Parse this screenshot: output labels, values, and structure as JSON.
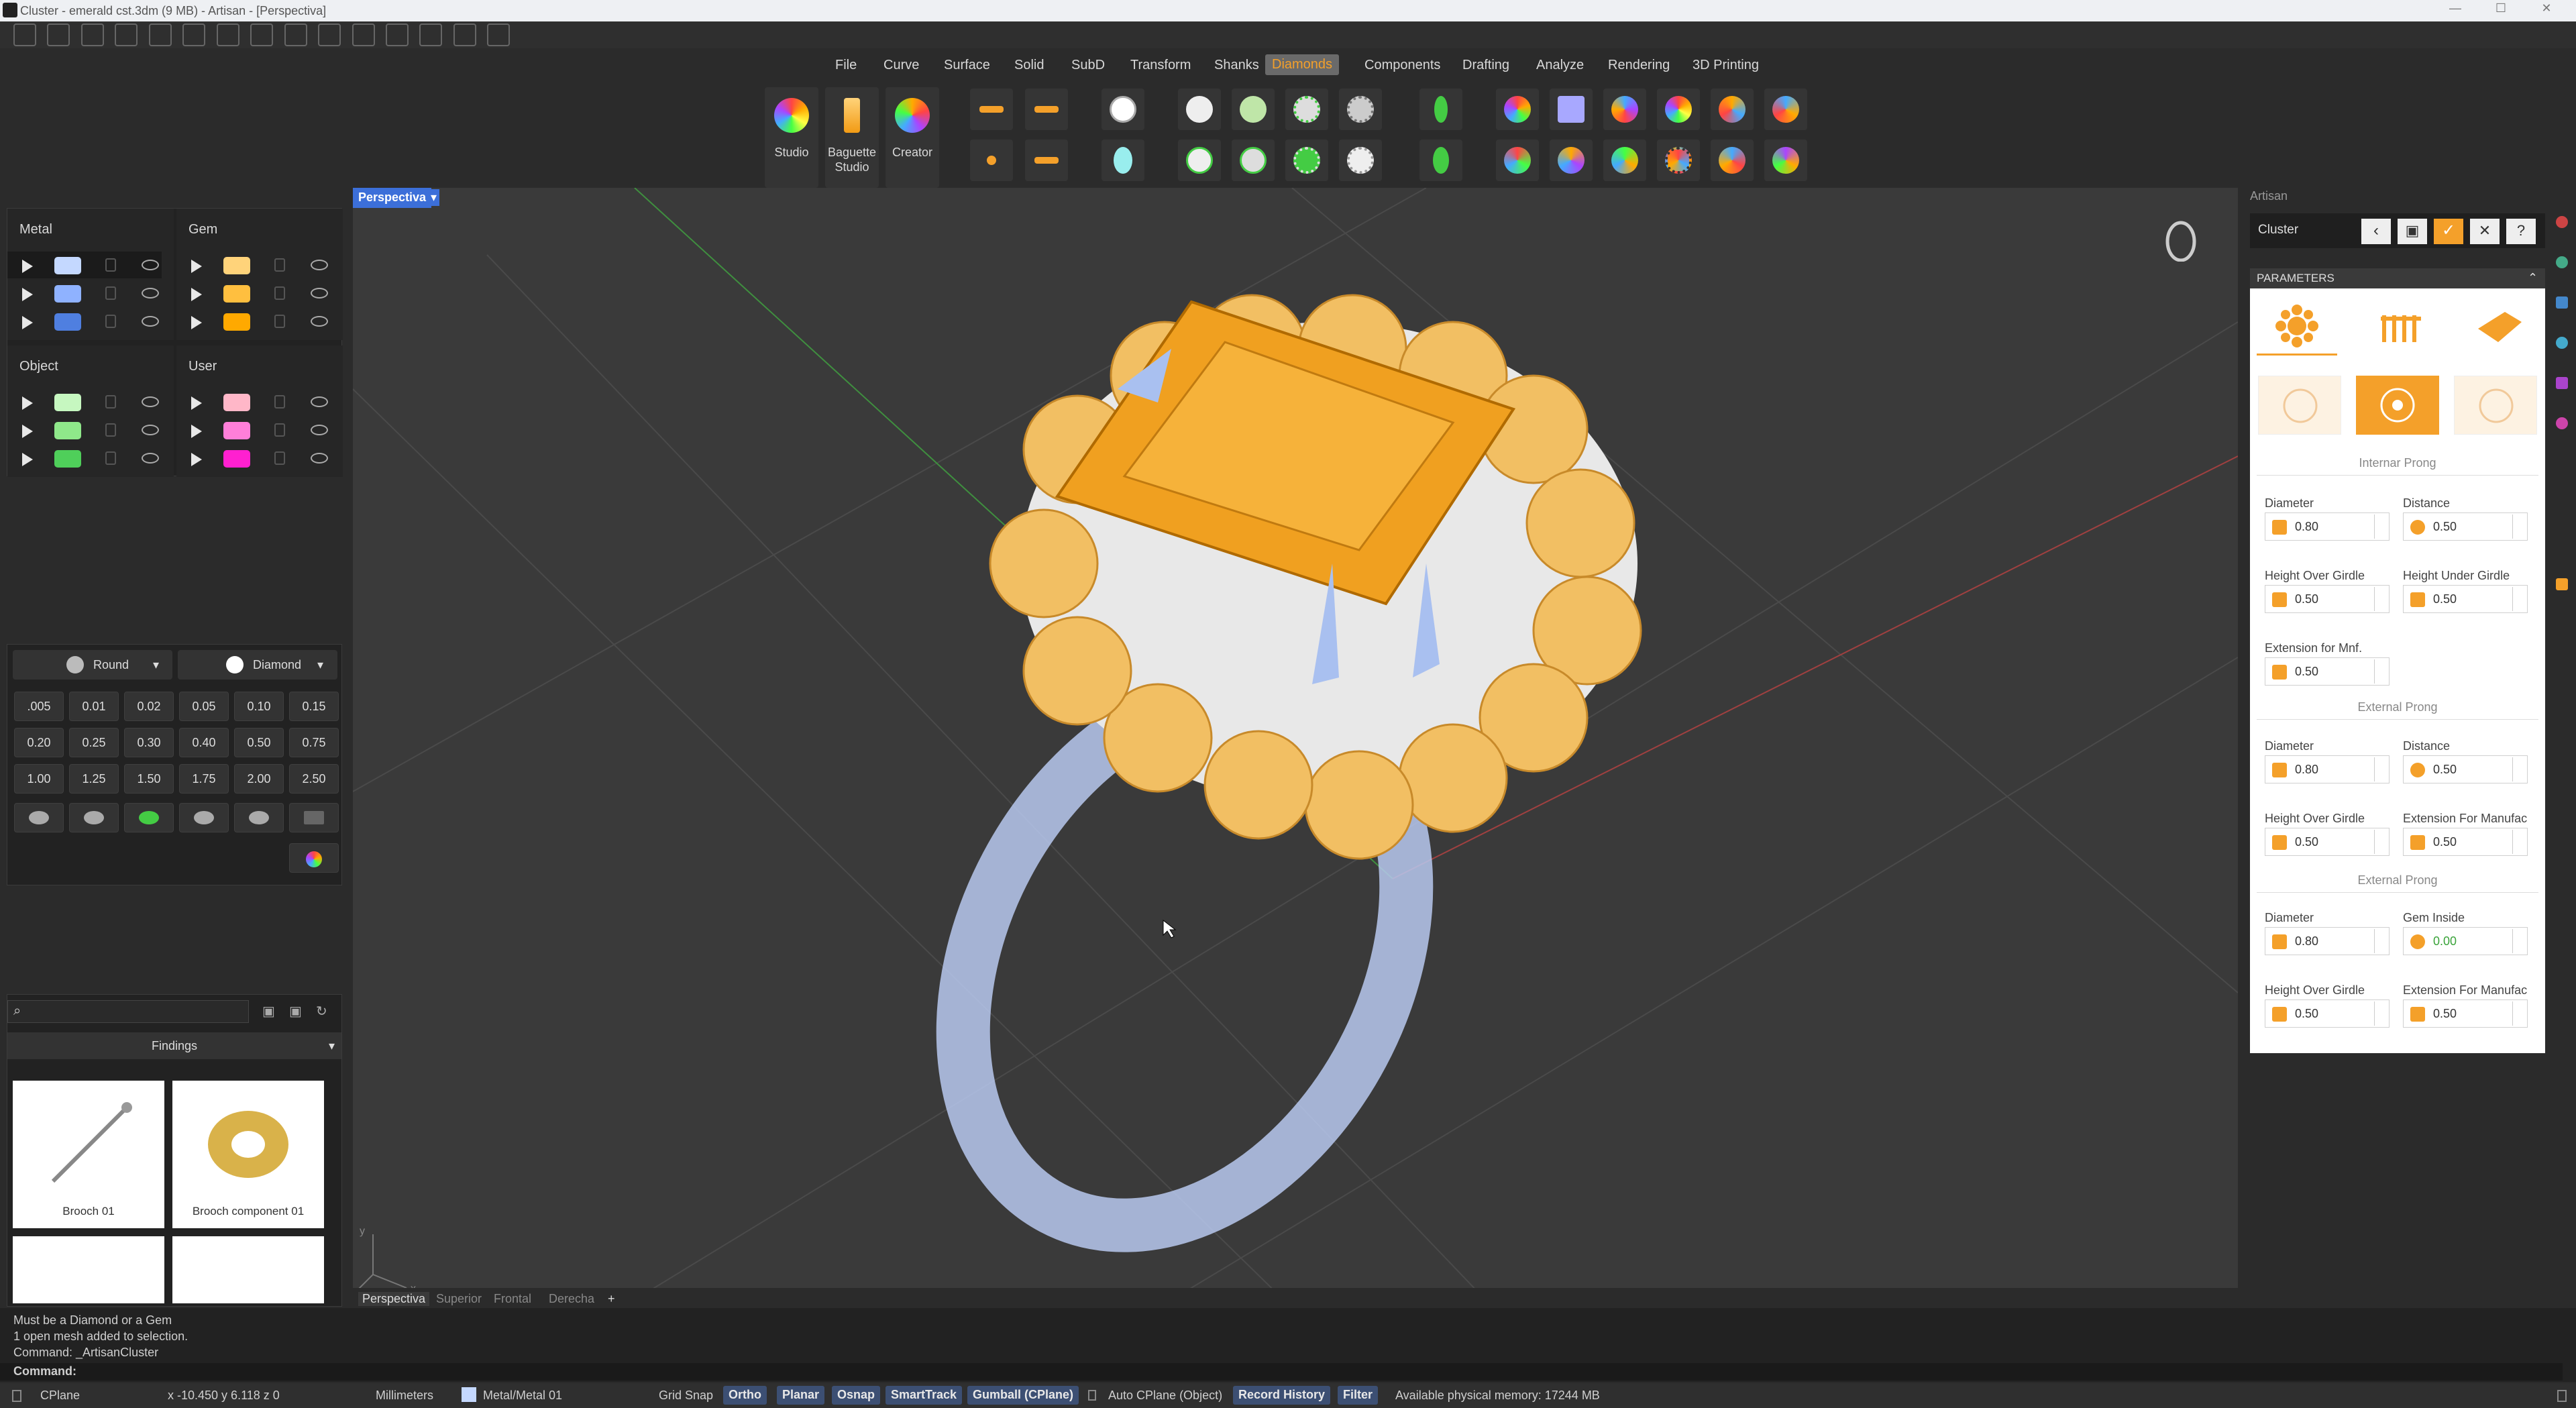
{
  "window": {
    "title": "Cluster - emerald cst.3dm (9 MB) - Artisan - [Perspectiva]"
  },
  "menu": [
    "File",
    "Curve",
    "Surface",
    "Solid",
    "SubD",
    "Transform",
    "Shanks",
    "Diamonds",
    "Components",
    "Drafting",
    "Analyze",
    "Rendering",
    "3D Printing"
  ],
  "menu_active": "Diamonds",
  "ribbon": {
    "studio": "Studio",
    "baguette": "Baguette Studio",
    "creator": "Creator"
  },
  "layers": {
    "metal": "Metal",
    "gem": "Gem",
    "object": "Object",
    "user": "User",
    "metal_colors": [
      "#c4d8ff",
      "#8fb2ff",
      "#4f7fe0"
    ],
    "gem_colors": [
      "#ffd37a",
      "#ffbf3f",
      "#ffa900"
    ],
    "object_colors": [
      "#c6f7c0",
      "#8fe88a",
      "#4fcf5a"
    ],
    "user_colors": [
      "#ffb7c8",
      "#ff7fd9",
      "#ff20d0"
    ]
  },
  "gem_picker": {
    "shape": "Round",
    "material": "Diamond",
    "sizes": [
      ".005",
      "0.01",
      "0.02",
      "0.05",
      "0.10",
      "0.15",
      "0.20",
      "0.25",
      "0.30",
      "0.40",
      "0.50",
      "0.75",
      "1.00",
      "1.25",
      "1.50",
      "1.75",
      "2.00",
      "2.50"
    ]
  },
  "library": {
    "category": "Findings",
    "items": [
      "Brooch 01",
      "Brooch component 01"
    ]
  },
  "viewport": {
    "name": "Perspectiva",
    "tabs": [
      "Perspectiva",
      "Superior",
      "Frontal",
      "Derecha"
    ],
    "add_tab": "+"
  },
  "artisan": {
    "panel_title": "Artisan",
    "command_name": "Cluster",
    "parameters_label": "PARAMETERS",
    "internal_prong": {
      "title": "Internar Prong",
      "diameter_label": "Diameter",
      "diameter": "0.80",
      "distance_label": "Distance",
      "distance": "0.50",
      "hog_label": "Height Over Girdle",
      "hog": "0.50",
      "hug_label": "Height Under Girdle",
      "hug": "0.50",
      "ext_label": "Extension for Mnf.",
      "ext": "0.50"
    },
    "external_prong_1": {
      "title": "External Prong",
      "diameter_label": "Diameter",
      "diameter": "0.80",
      "distance_label": "Distance",
      "distance": "0.50",
      "hog_label": "Height Over Girdle",
      "hog": "0.50",
      "ext_label": "Extension For Manufac",
      "ext": "0.50"
    },
    "external_prong_2": {
      "title": "External Prong",
      "diameter_label": "Diameter",
      "diameter": "0.80",
      "gem_inside_label": "Gem Inside",
      "gem_inside": "0.00",
      "hog_label": "Height Over Girdle",
      "hog": "0.50",
      "ext_label": "Extension For Manufac",
      "ext": "0.50"
    }
  },
  "command": {
    "history": [
      "Must be a Diamond or a Gem",
      "1 open mesh added to selection.",
      "Command: _ArtisanCluster"
    ],
    "prompt": "Command:"
  },
  "status": {
    "cplane": "CPlane",
    "coords": "x -10.450  y 6.118  z 0",
    "units": "Millimeters",
    "layer": "Metal/Metal 01",
    "grid_snap": "Grid Snap",
    "ortho": "Ortho",
    "planar": "Planar",
    "osnap": "Osnap",
    "smarttrack": "SmartTrack",
    "gumball": "Gumball (CPlane)",
    "autocplane": "Auto CPlane (Object)",
    "record": "Record History",
    "filter": "Filter",
    "memory": "Available physical memory: 17244 MB"
  }
}
